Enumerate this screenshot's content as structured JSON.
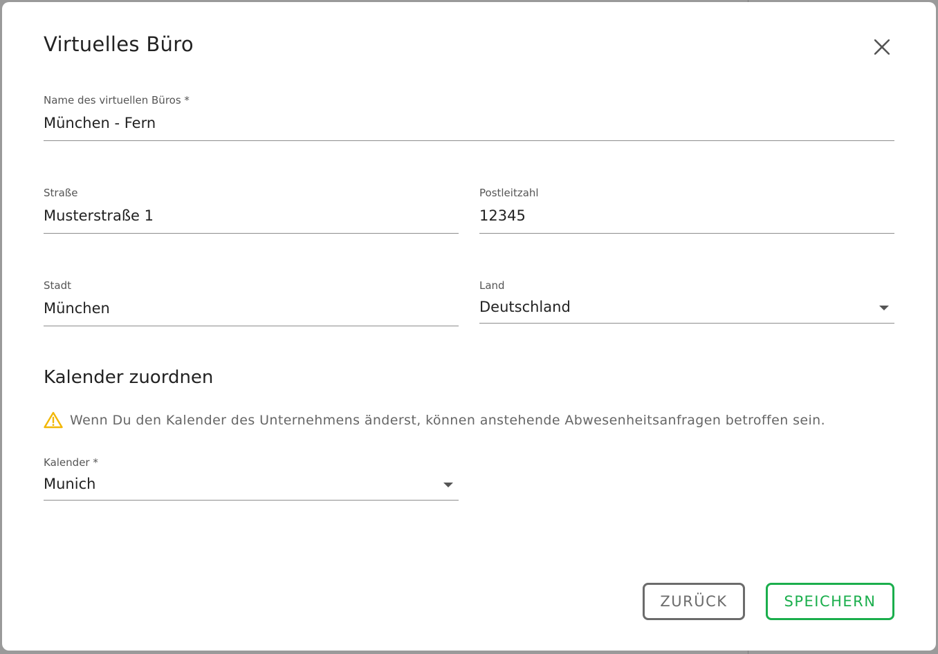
{
  "dialog": {
    "title": "Virtuelles Büro"
  },
  "fields": {
    "name": {
      "label": "Name des virtuellen Büros *",
      "value": "München - Fern"
    },
    "street": {
      "label": "Straße",
      "value": "Musterstraße 1"
    },
    "zip": {
      "label": "Postleitzahl",
      "value": "12345"
    },
    "city": {
      "label": "Stadt",
      "value": "München"
    },
    "country": {
      "label": "Land",
      "value": "Deutschland"
    }
  },
  "calendar_section": {
    "title": "Kalender zuordnen",
    "warning": "Wenn Du den Kalender des Unternehmens änderst, können anstehende Abwesenheitsanfragen betroffen sein.",
    "calendar_field": {
      "label": "Kalender *",
      "value": "Munich"
    }
  },
  "actions": {
    "back_label": "ZURÜCK",
    "save_label": "SPEICHERN"
  },
  "colors": {
    "accent_green": "#1aae4c",
    "warning_yellow": "#f2b705"
  }
}
